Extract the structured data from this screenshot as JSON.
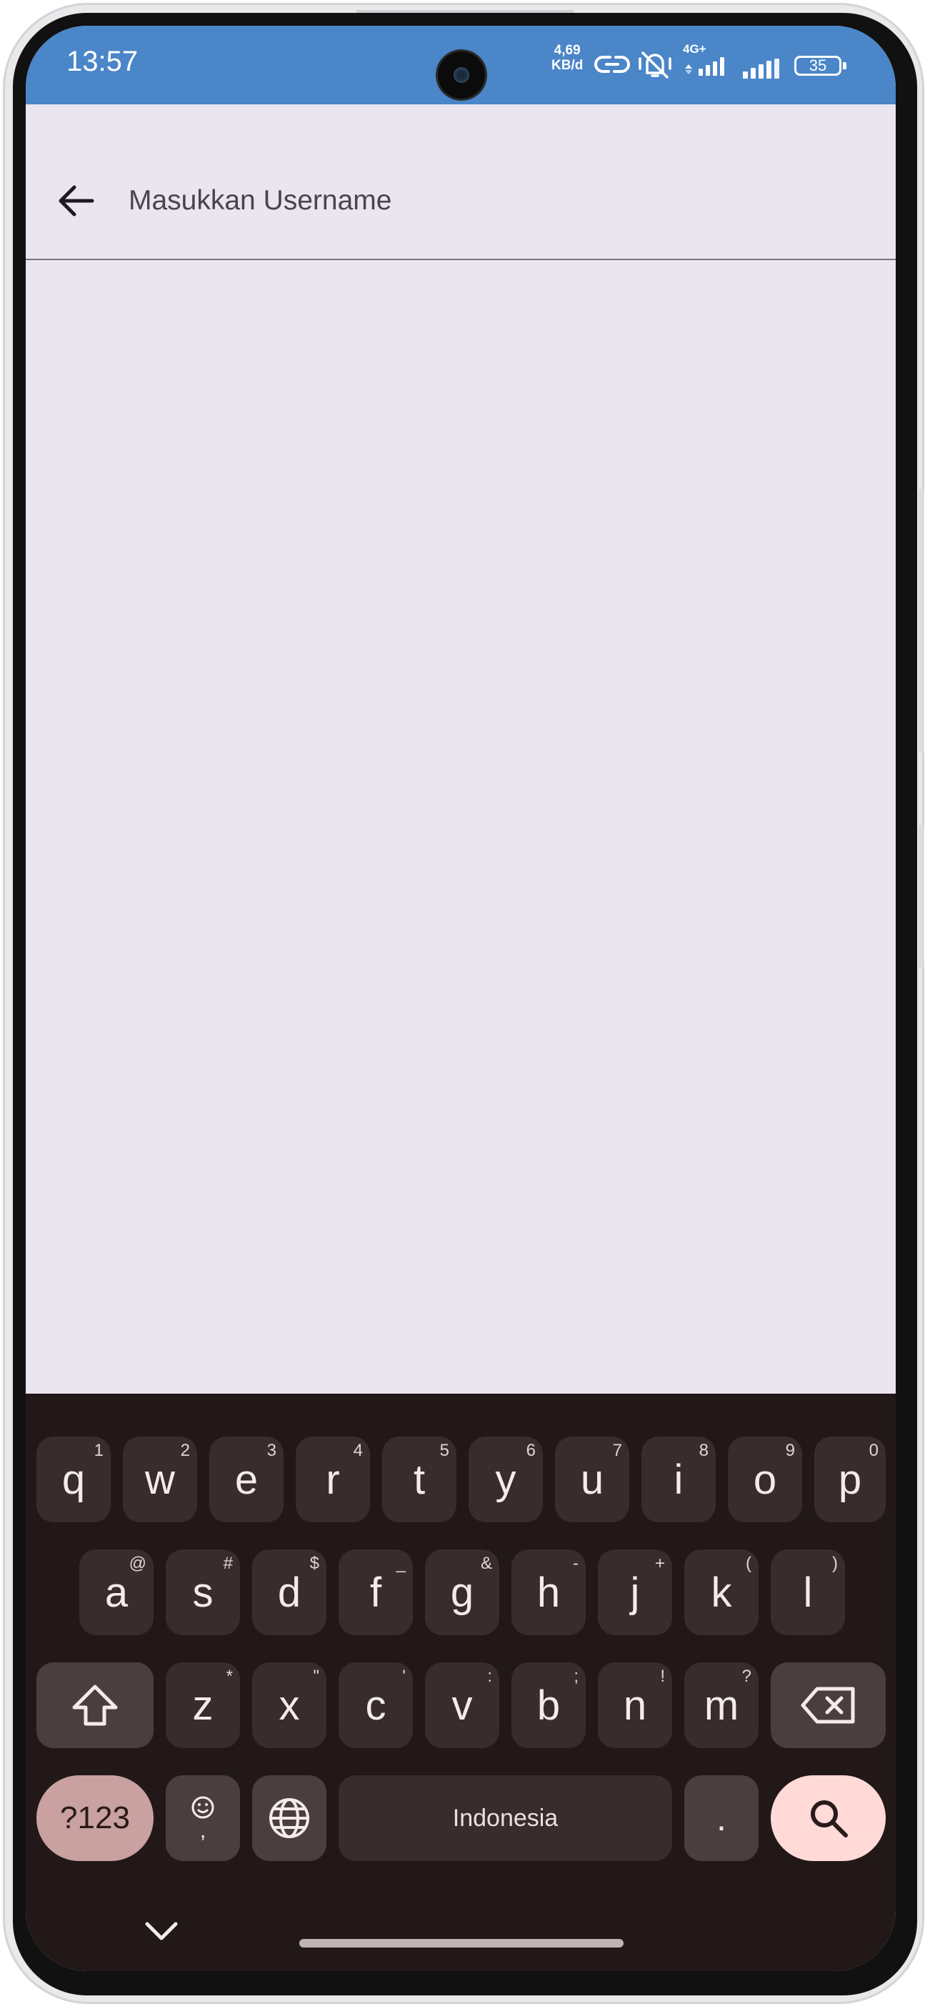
{
  "status_bar": {
    "time": "13:57",
    "net_speed_value": "4,69",
    "net_speed_unit": "KB/d",
    "network_label": "4G+",
    "battery": "35",
    "icons": [
      "link-icon",
      "mute-vibrate-icon",
      "signal-4g-icon",
      "signal-icon",
      "battery-icon"
    ]
  },
  "app_bar": {
    "back_icon": "arrow-back-icon",
    "search_placeholder": "Masukkan Username",
    "search_value": ""
  },
  "keyboard": {
    "row1": [
      {
        "key": "q",
        "hint": "1"
      },
      {
        "key": "w",
        "hint": "2"
      },
      {
        "key": "e",
        "hint": "3"
      },
      {
        "key": "r",
        "hint": "4"
      },
      {
        "key": "t",
        "hint": "5"
      },
      {
        "key": "y",
        "hint": "6"
      },
      {
        "key": "u",
        "hint": "7"
      },
      {
        "key": "i",
        "hint": "8"
      },
      {
        "key": "o",
        "hint": "9"
      },
      {
        "key": "p",
        "hint": "0"
      }
    ],
    "row2": [
      {
        "key": "a",
        "hint": "@"
      },
      {
        "key": "s",
        "hint": "#"
      },
      {
        "key": "d",
        "hint": "$"
      },
      {
        "key": "f",
        "hint": "_"
      },
      {
        "key": "g",
        "hint": "&"
      },
      {
        "key": "h",
        "hint": "-"
      },
      {
        "key": "j",
        "hint": "+"
      },
      {
        "key": "k",
        "hint": "("
      },
      {
        "key": "l",
        "hint": ")"
      }
    ],
    "row3": [
      {
        "key": "z",
        "hint": "*"
      },
      {
        "key": "x",
        "hint": "\""
      },
      {
        "key": "c",
        "hint": "'"
      },
      {
        "key": "v",
        "hint": ":"
      },
      {
        "key": "b",
        "hint": ";"
      },
      {
        "key": "n",
        "hint": "!"
      },
      {
        "key": "m",
        "hint": "?"
      }
    ],
    "symbols_label": "?123",
    "comma_label": ",",
    "emoji_icon": "emoji-icon",
    "globe_icon": "globe-icon",
    "space_label": "Indonesia",
    "period_label": ".",
    "shift_icon": "shift-icon",
    "backspace_icon": "backspace-icon",
    "search_icon": "search-icon",
    "hide_icon": "chevron-down-icon",
    "colors": {
      "background": "#221818",
      "key": "#382c2c",
      "accent": "#ffdad6"
    }
  }
}
